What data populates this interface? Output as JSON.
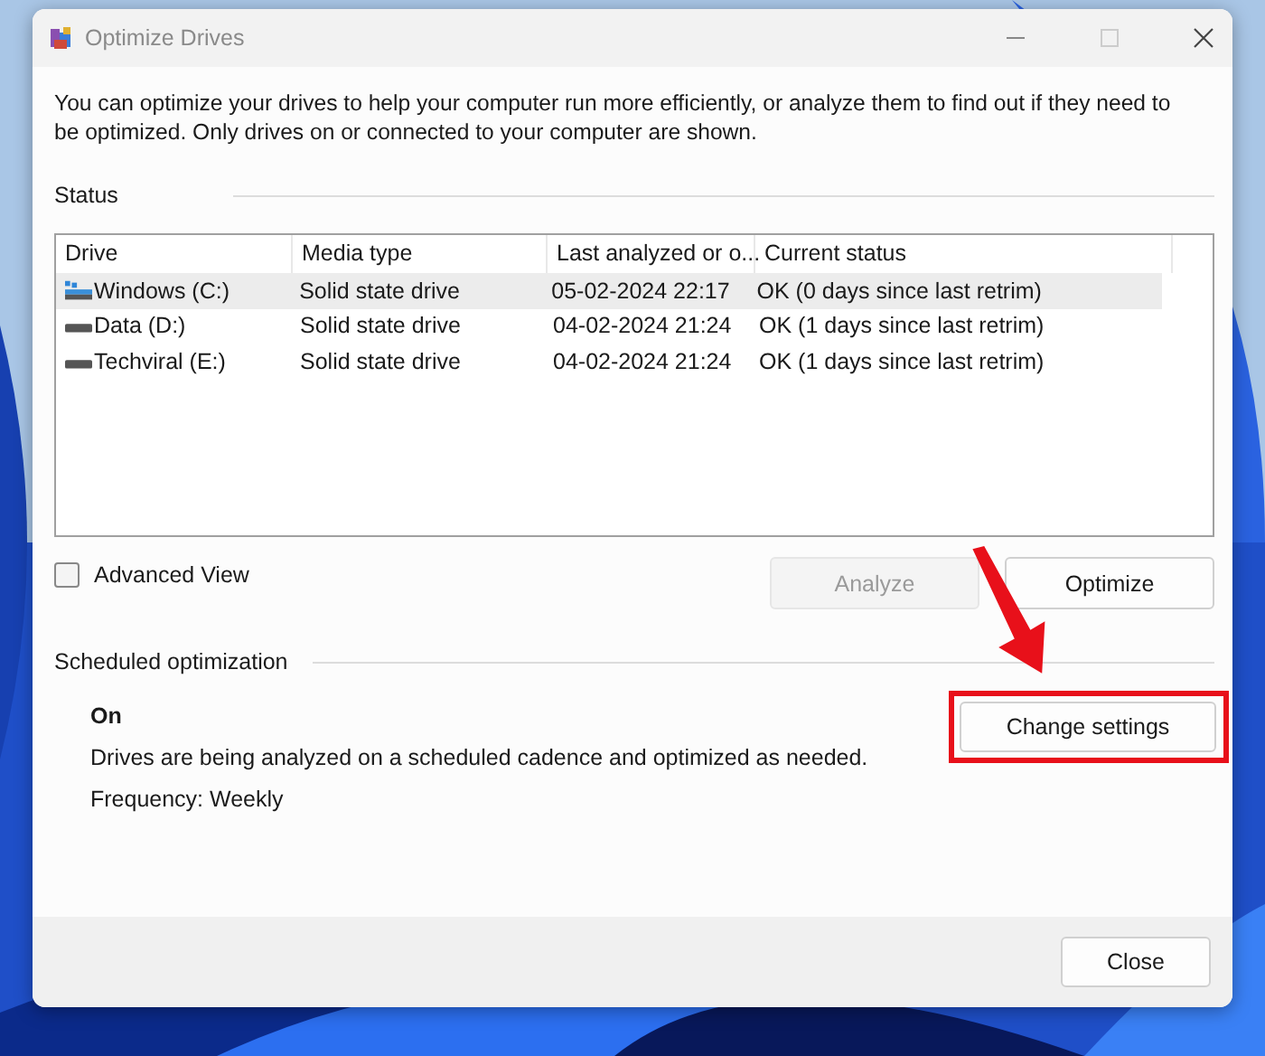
{
  "window": {
    "title": "Optimize Drives"
  },
  "description": "You can optimize your drives to help your computer run more efficiently, or analyze them to find out if they need to be optimized. Only drives on or connected to your computer are shown.",
  "status": {
    "heading": "Status",
    "table": {
      "columns": [
        "Drive",
        "Media type",
        "Last analyzed or o...",
        "Current status"
      ],
      "rows": [
        {
          "kind": "system",
          "selected": true,
          "cells": [
            "Windows (C:)",
            "Solid state drive",
            "05-02-2024 22:17",
            "OK (0 days since last retrim)"
          ]
        },
        {
          "kind": "disk",
          "selected": false,
          "cells": [
            "Data (D:)",
            "Solid state drive",
            "04-02-2024 21:24",
            "OK (1 days since last retrim)"
          ]
        },
        {
          "kind": "disk",
          "selected": false,
          "cells": [
            "Techviral (E:)",
            "Solid state drive",
            "04-02-2024 21:24",
            "OK (1 days since last retrim)"
          ]
        }
      ]
    }
  },
  "advanced_view": {
    "label": "Advanced View",
    "checked": false
  },
  "buttons": [
    {
      "label": "Analyze",
      "disabled": true
    },
    {
      "label": "Optimize",
      "disabled": false
    }
  ],
  "scheduled": {
    "heading": "Scheduled optimization",
    "state": "On",
    "text": "Drives are being analyzed on a scheduled cadence and optimized as needed.",
    "frequency": "Frequency: Weekly",
    "button": {
      "label": "Change settings"
    }
  },
  "footer": {
    "close": "Close"
  }
}
